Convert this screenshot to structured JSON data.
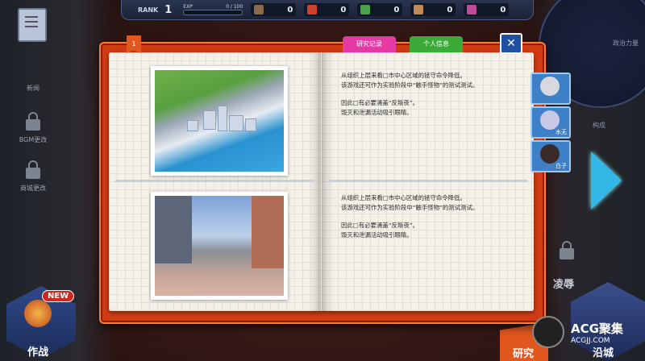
{
  "topbar": {
    "rank_label": "RANK",
    "rank_value": "1",
    "exp_label": "EXP",
    "exp_value": "0 / 100",
    "exp_progress": 0,
    "resources": [
      {
        "icon": "box-icon",
        "value": "0",
        "color": "#8a6a4a"
      },
      {
        "icon": "flask-icon",
        "value": "0",
        "color": "#d0402a"
      },
      {
        "icon": "magnifier-icon",
        "value": "0",
        "color": "#4aa34a"
      },
      {
        "icon": "person-icon",
        "value": "0",
        "color": "#c08a5a"
      },
      {
        "icon": "pill-icon",
        "value": "0",
        "color": "#c04a9a"
      }
    ]
  },
  "left_menu": {
    "items": [
      {
        "label": "新闻",
        "icon": "clipboard-icon"
      },
      {
        "label": "BGM更改",
        "icon": "lock-icon"
      },
      {
        "label": "商城更改",
        "icon": "lock-icon"
      }
    ],
    "combat": {
      "label": "作战",
      "badge": "NEW"
    }
  },
  "right_menu": {
    "radar_labels": [
      "政治力量",
      "构成"
    ],
    "locked_label": "凌辱",
    "research_label": "研究",
    "deploy_label": "沿城"
  },
  "book": {
    "page_tag": "1",
    "tabs": {
      "research": "研究记录",
      "personal": "个人信息"
    },
    "entries": [
      {
        "image": "city-map",
        "line1": "从组织上层来看□市中心区域的拯守命令降低。",
        "line2": "该游戏还可作为实验阶段中“触手怪物”的测试测试。",
        "line3": "因此□有必要涌盖“反叛夜”。",
        "line4": "毁灭和泄漏活动吸引眼睛。"
      },
      {
        "image": "street",
        "line1": "从组织上层来看□市中心区域的拯守命令降低。",
        "line2": "该游戏还可作为实验阶段中“触手怪物”的测试测试。",
        "line3": "因此□有必要涌盖“反叛夜”。",
        "line4": "毁灭和泄漏活动吸引眼睛。"
      }
    ]
  },
  "characters": [
    {
      "name": "",
      "hair": "#d8d8e0"
    },
    {
      "name": "水无",
      "hair": "#c8c8e8"
    },
    {
      "name": "白子",
      "hair": "#3a2a2a"
    }
  ],
  "watermark": {
    "title": "ACG聚集",
    "subtitle": "ACGJJ.COM"
  }
}
